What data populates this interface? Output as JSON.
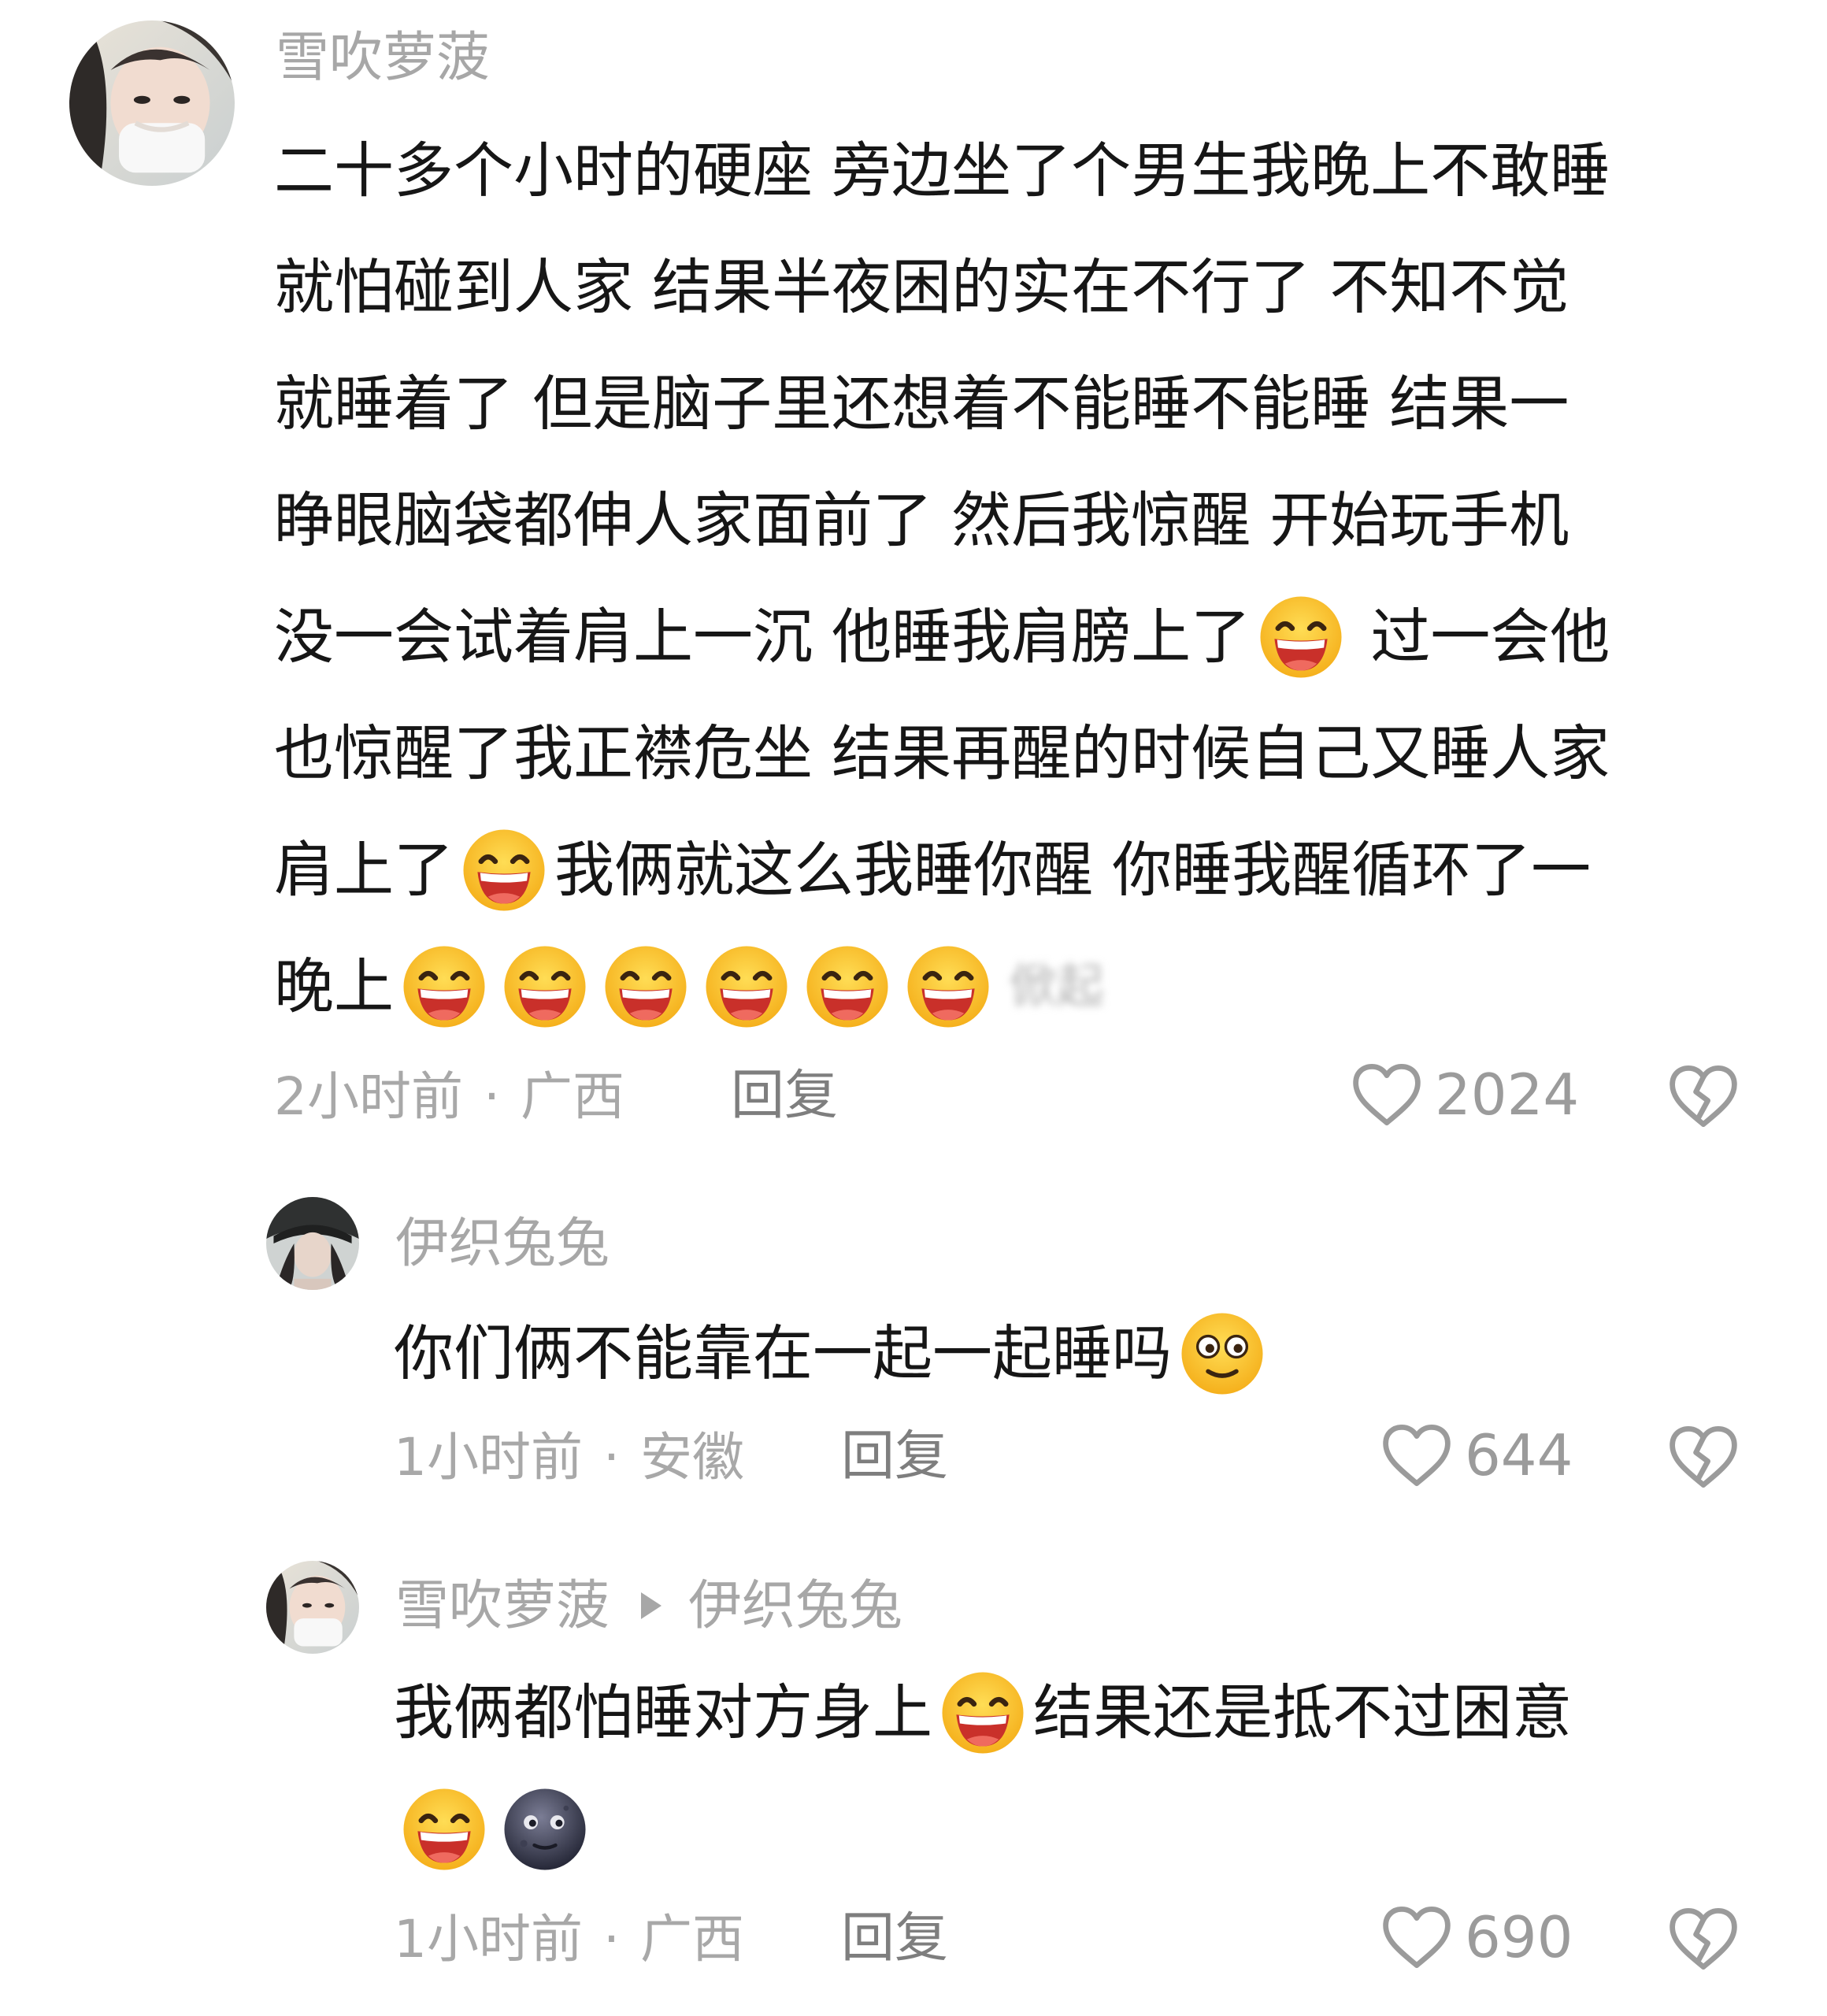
{
  "comments": [
    {
      "username": "雪吹萝菠",
      "lines": [
        [
          {
            "t": "二十多个小时的硬座 旁边坐了个男生我晚上不敢睡"
          }
        ],
        [
          {
            "t": "就怕碰到人家 结果半夜困的实在不行了 不知不觉"
          }
        ],
        [
          {
            "t": "就睡着了 但是脑子里还想着不能睡不能睡 结果一"
          }
        ],
        [
          {
            "t": "睁眼脑袋都伸人家面前了 然后我惊醒 开始玩手机"
          }
        ],
        [
          {
            "t": "没一会试着肩上一沉 他睡我肩膀上了"
          },
          {
            "e": "grin"
          },
          {
            "t": " 过一会他"
          }
        ],
        [
          {
            "t": "也惊醒了我正襟危坐 结果再醒的时候自己又睡人家"
          }
        ],
        [
          {
            "t": "肩上了"
          },
          {
            "e": "grin"
          },
          {
            "t": "我俩就这么我睡你醒 你睡我醒循环了一"
          }
        ],
        [
          {
            "t": "晚上"
          },
          {
            "e": "grin"
          },
          {
            "e": "grin"
          },
          {
            "e": "grin"
          },
          {
            "e": "grin"
          },
          {
            "e": "grin"
          },
          {
            "e": "grin"
          },
          {
            "blur": "俽起"
          }
        ]
      ],
      "time": "2小时前",
      "location": "广西",
      "reply_label": "回复",
      "likes": "2024"
    },
    {
      "username": "伊织兔兔",
      "lines": [
        [
          {
            "t": "你们俩不能靠在一起一起睡吗"
          },
          {
            "e": "wonder"
          }
        ]
      ],
      "time": "1小时前",
      "location": "安徽",
      "reply_label": "回复",
      "likes": "644"
    },
    {
      "username": "雪吹萝菠",
      "reply_to": "伊织兔兔",
      "lines": [
        [
          {
            "t": "我俩都怕睡对方身上"
          },
          {
            "e": "grin"
          },
          {
            "t": "结果还是抵不过困意"
          }
        ],
        [
          {
            "e": "grin"
          },
          {
            "e": "moon"
          }
        ]
      ],
      "time": "1小时前",
      "location": "广西",
      "reply_label": "回复",
      "likes": "690"
    }
  ],
  "meta_separator": "·",
  "icons": {
    "like": "heart-outline-icon",
    "dislike": "broken-heart-icon",
    "reply_arrow": "triangle-right-icon"
  },
  "colors": {
    "text": "#161616",
    "muted": "#a7a7a7",
    "emoji_yellow": "#fbc326",
    "emoji_mouth": "#d3362e"
  }
}
